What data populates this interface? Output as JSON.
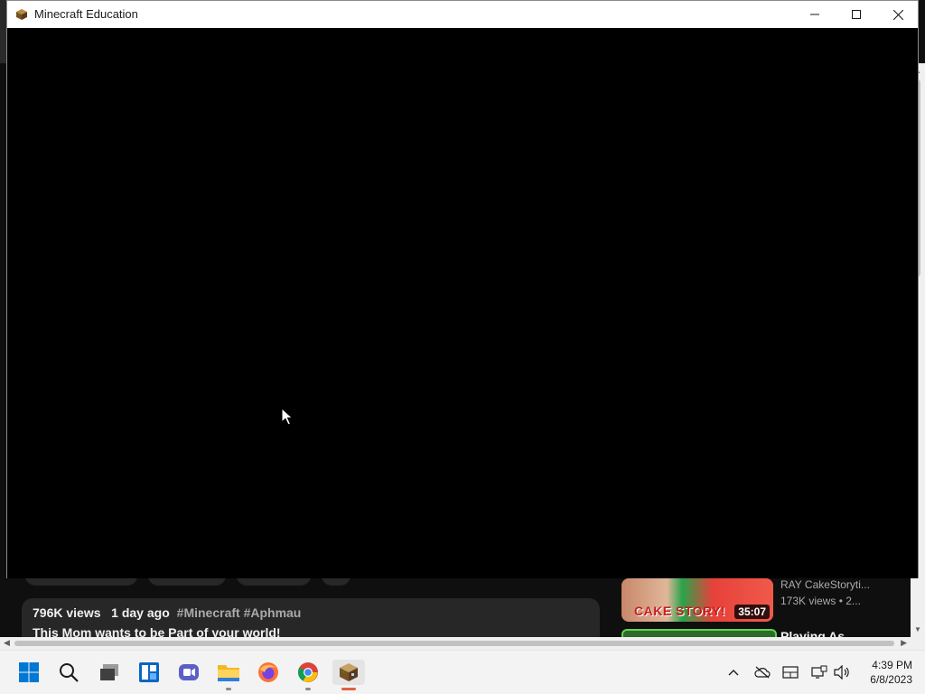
{
  "window": {
    "title": "Minecraft Education",
    "minimize_label": "Minimize",
    "maximize_label": "Maximize",
    "close_label": "Close"
  },
  "background_page": {
    "video_meta": {
      "views": "796K views",
      "age": "1 day ago",
      "tags": "#Minecraft #Aphmau"
    },
    "description": "This Mom wants to be Part of your world!",
    "recommendations": [
      {
        "thumbnail_text": "CAKE STORY!",
        "duration": "35:07",
        "channel": "RAY CakeStoryti...",
        "views": "173K views",
        "age": "• 2..."
      },
      {
        "title": "Playing As..."
      }
    ]
  },
  "taskbar": {
    "apps": [
      {
        "name": "start",
        "icon": "windows-logo-icon"
      },
      {
        "name": "search",
        "icon": "search-icon"
      },
      {
        "name": "task-view",
        "icon": "task-view-icon"
      },
      {
        "name": "widgets",
        "icon": "widgets-icon"
      },
      {
        "name": "teams",
        "icon": "teams-icon"
      },
      {
        "name": "file-explorer",
        "icon": "folder-icon"
      },
      {
        "name": "firefox",
        "icon": "firefox-icon"
      },
      {
        "name": "chrome",
        "icon": "chrome-icon"
      },
      {
        "name": "minecraft-education",
        "icon": "minecraft-icon"
      }
    ],
    "clock": {
      "time": "4:39 PM",
      "date": "6/8/2023"
    }
  },
  "colors": {
    "titlebar": "#ffffff",
    "game_area": "#000000",
    "taskbar": "#f3f3f3",
    "youtube_bg": "#0f0f0f",
    "active_app_indicator": "#e06040"
  }
}
